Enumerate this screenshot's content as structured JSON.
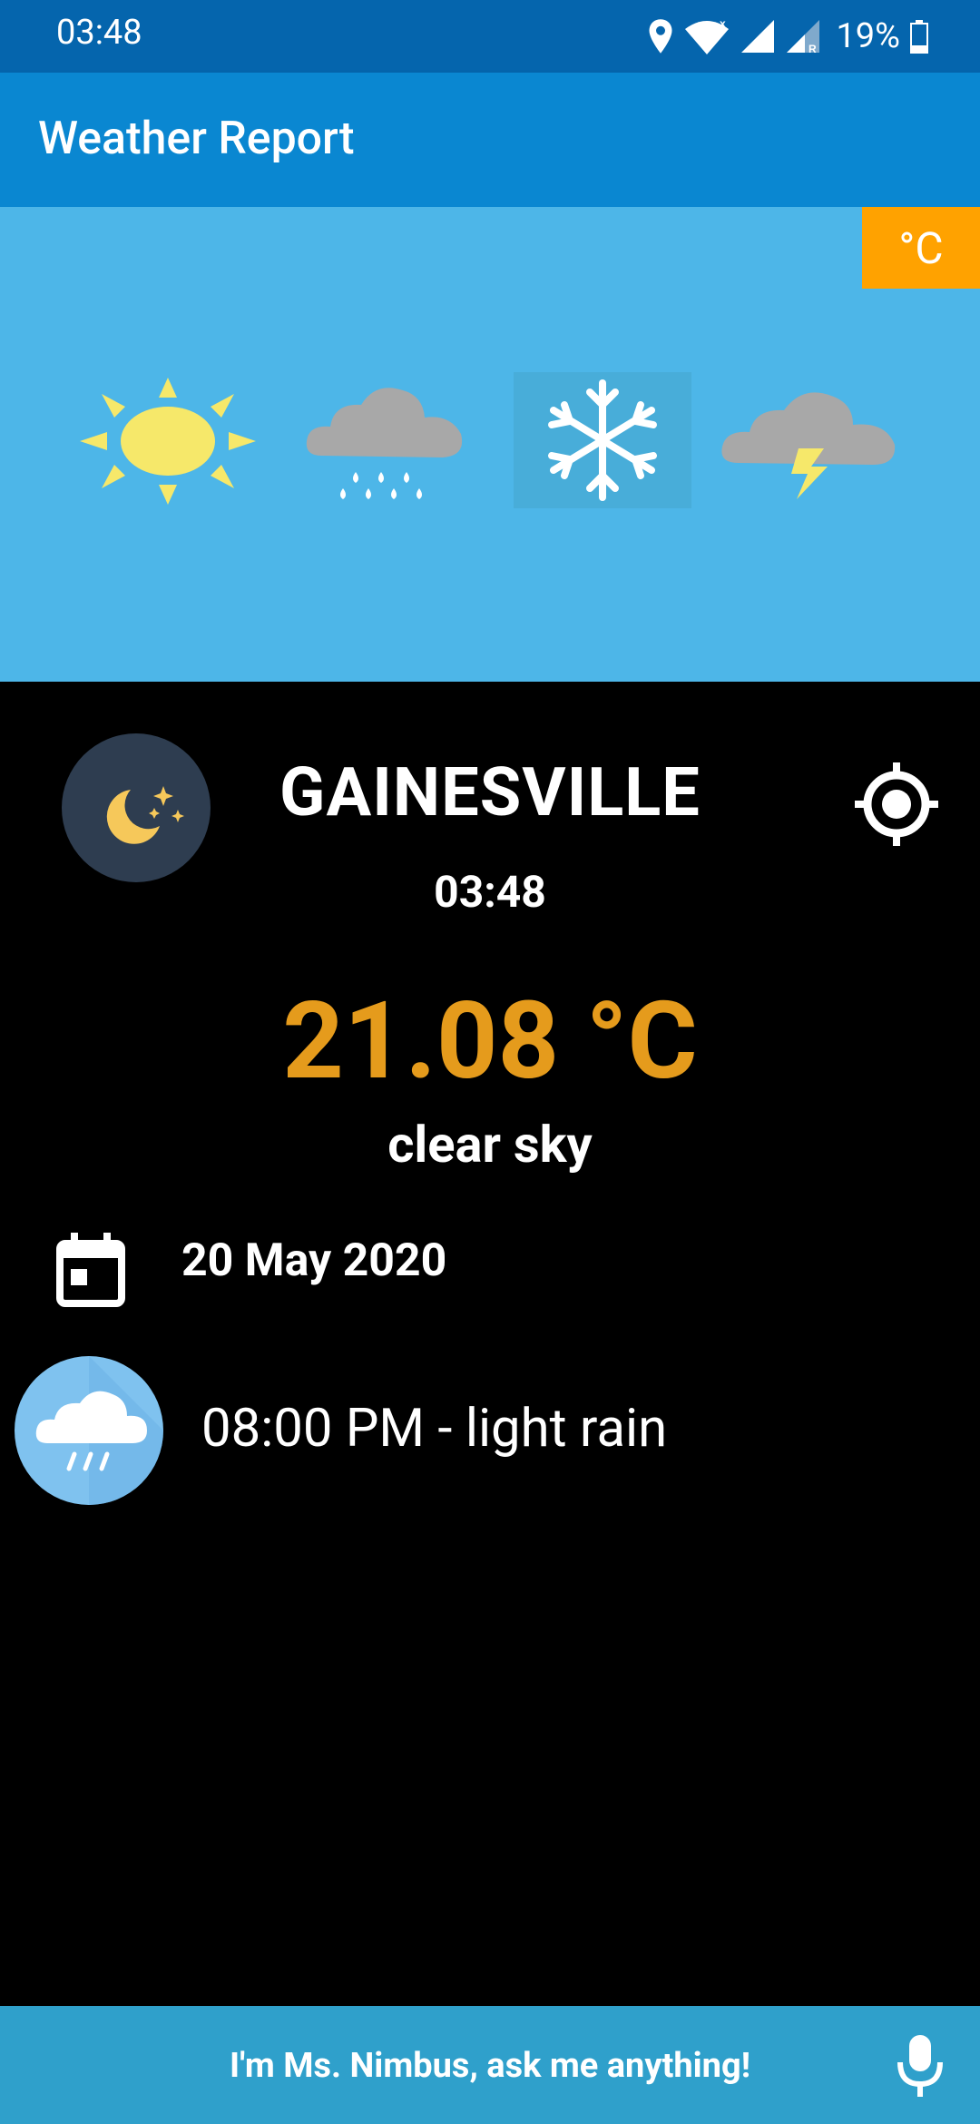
{
  "status_bar": {
    "time": "03:48",
    "battery": "19%"
  },
  "app_bar": {
    "title": "Weather Report"
  },
  "banner": {
    "unit_button": "°C",
    "icons": [
      "sun-icon",
      "rain-cloud-icon",
      "snowflake-icon",
      "thunder-cloud-icon"
    ]
  },
  "current": {
    "city": "GAINESVILLE",
    "time": "03:48",
    "temperature": "21.08 °C",
    "description": "clear sky",
    "date": "20 May 2020",
    "condition_icon": "night-moon-icon"
  },
  "forecast": {
    "text": "08:00 PM - light rain",
    "icon": "rain-cloud-icon"
  },
  "assistant": {
    "prompt": "I'm Ms. Nimbus, ask me anything!"
  },
  "colors": {
    "status_bar": "#0565ad",
    "app_bar": "#0a87d1",
    "banner": "#4db6e8",
    "unit_button": "#ffa200",
    "temperature": "#e59b1c",
    "assistant_bar": "#2fa0cb"
  }
}
